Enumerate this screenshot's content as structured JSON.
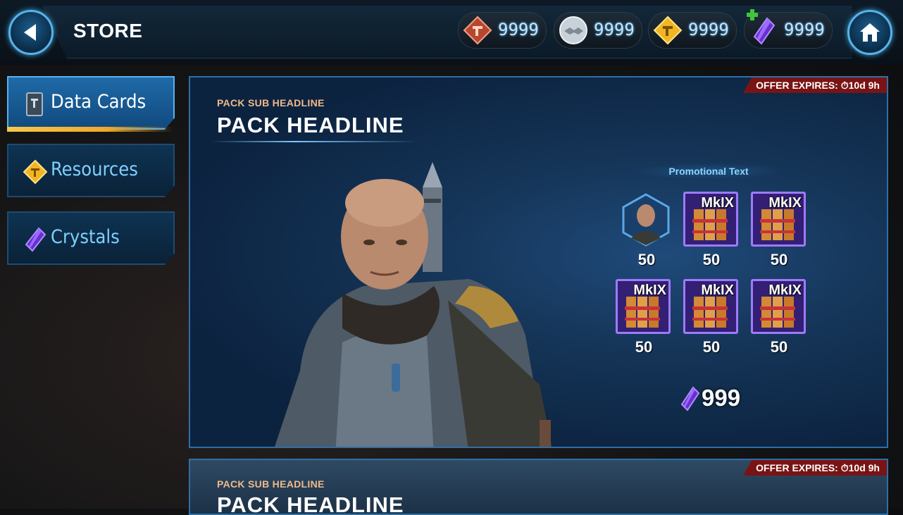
{
  "header": {
    "title": "STORE"
  },
  "currencies": [
    {
      "icon": "shipment-credits-icon",
      "value": "9999"
    },
    {
      "icon": "ally-points-icon",
      "value": "9999"
    },
    {
      "icon": "credits-icon",
      "value": "9999"
    },
    {
      "icon": "crystals-icon",
      "value": "9999"
    }
  ],
  "tabs": [
    {
      "label": "Data Cards",
      "icon": "data-card-icon",
      "active": true
    },
    {
      "label": "Resources",
      "icon": "resources-icon",
      "active": false
    },
    {
      "label": "Crystals",
      "icon": "crystal-icon",
      "active": false
    }
  ],
  "packs": [
    {
      "offer": "OFFER EXPIRES: ⏱10d 9h",
      "sub_headline": "PACK SUB HEADLINE",
      "headline": "PACK HEADLINE",
      "promo_text": "Promotional Text",
      "rewards": [
        {
          "type": "character-shard",
          "label": "",
          "qty": "50"
        },
        {
          "type": "gear",
          "label": "MkIX",
          "qty": "50"
        },
        {
          "type": "gear",
          "label": "MkIX",
          "qty": "50"
        },
        {
          "type": "gear",
          "label": "MkIX",
          "qty": "50"
        },
        {
          "type": "gear",
          "label": "MkIX",
          "qty": "50"
        },
        {
          "type": "gear",
          "label": "MkIX",
          "qty": "50"
        }
      ],
      "price": "999"
    },
    {
      "offer": "OFFER EXPIRES: ⏱10d 9h",
      "sub_headline": "PACK SUB HEADLINE",
      "headline": "PACK HEADLINE"
    }
  ]
}
